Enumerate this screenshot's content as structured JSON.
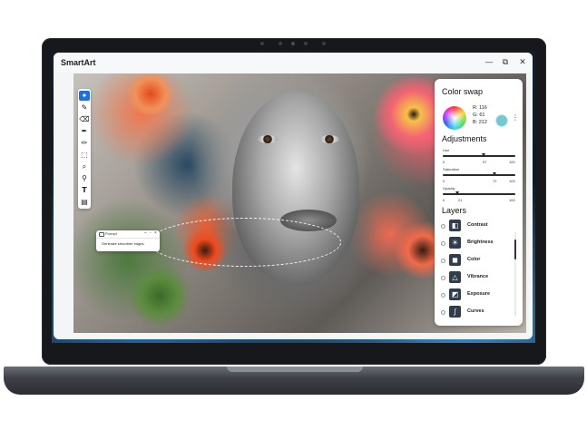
{
  "app": {
    "title": "SmartArt",
    "window_controls": {
      "minimize": "—",
      "restore": "⧉",
      "close": "✕"
    }
  },
  "toolbar": {
    "tools": [
      {
        "name": "ai-tool",
        "glyph": "✦",
        "active": true
      },
      {
        "name": "brush-tool",
        "glyph": "✎"
      },
      {
        "name": "eraser-tool",
        "glyph": "⌫"
      },
      {
        "name": "pen-tool",
        "glyph": "✒"
      },
      {
        "name": "pencil-tool",
        "glyph": "✏"
      },
      {
        "name": "crop-tool",
        "glyph": "⬚"
      },
      {
        "name": "zoom-tool",
        "glyph": "⌕"
      },
      {
        "name": "dropper-tool",
        "glyph": "⚲"
      },
      {
        "name": "text-tool",
        "glyph": "T"
      },
      {
        "name": "layers-tool",
        "glyph": "▤"
      }
    ]
  },
  "prompt": {
    "title": "Prompt",
    "text": "Generate smoother edges."
  },
  "color_swap": {
    "heading": "Color swap",
    "r_label": "R:",
    "r_value": "116",
    "g_label": "G:",
    "g_value": "61",
    "b_label": "B:",
    "b_value": "212",
    "chip_color": "#74c9cf"
  },
  "adjustments": {
    "heading": "Adjustments",
    "sliders": [
      {
        "label": "Hue",
        "min": "0",
        "value": "57",
        "max": "100",
        "fraction": 0.57
      },
      {
        "label": "Saturation",
        "min": "0",
        "value": "72",
        "max": "100",
        "fraction": 0.72
      },
      {
        "label": "Opacity",
        "min": "0",
        "value": "21",
        "max": "100",
        "fraction": 0.21
      }
    ]
  },
  "layers": {
    "heading": "Layers",
    "items": [
      {
        "label": "Contrast",
        "icon": "contrast-icon",
        "glyph": "◧"
      },
      {
        "label": "Brightness",
        "icon": "brightness-icon",
        "glyph": "☀"
      },
      {
        "label": "Color",
        "icon": "color-icon",
        "glyph": "◼"
      },
      {
        "label": "Vibrance",
        "icon": "vibrance-icon",
        "glyph": "△"
      },
      {
        "label": "Exposure",
        "icon": "exposure-icon",
        "glyph": "◩"
      },
      {
        "label": "Curves",
        "icon": "curves-icon",
        "glyph": "∫"
      }
    ]
  }
}
